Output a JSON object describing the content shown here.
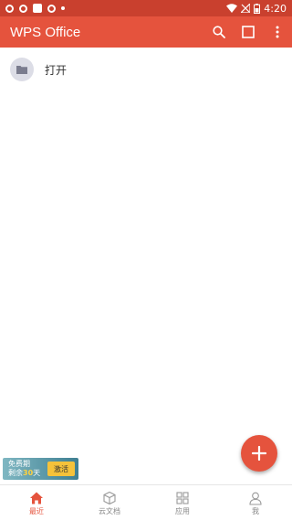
{
  "status_bar": {
    "time": "4:20"
  },
  "app_bar": {
    "title": "WPS Office"
  },
  "recent": {
    "open_label": "打开"
  },
  "promo": {
    "line1": "免费期",
    "line2_prefix": "剩余",
    "days": "30",
    "line2_suffix": "天",
    "button_label": "激活"
  },
  "bottom_nav": {
    "items": [
      {
        "label": "最近",
        "icon": "home-icon",
        "active": true
      },
      {
        "label": "云文档",
        "icon": "cube-icon",
        "active": false
      },
      {
        "label": "应用",
        "icon": "grid-icon",
        "active": false
      },
      {
        "label": "我",
        "icon": "person-icon",
        "active": false
      }
    ]
  },
  "colors": {
    "primary": "#e5533d",
    "status_bar": "#c9402e",
    "folder_bg": "#dcdde6"
  }
}
